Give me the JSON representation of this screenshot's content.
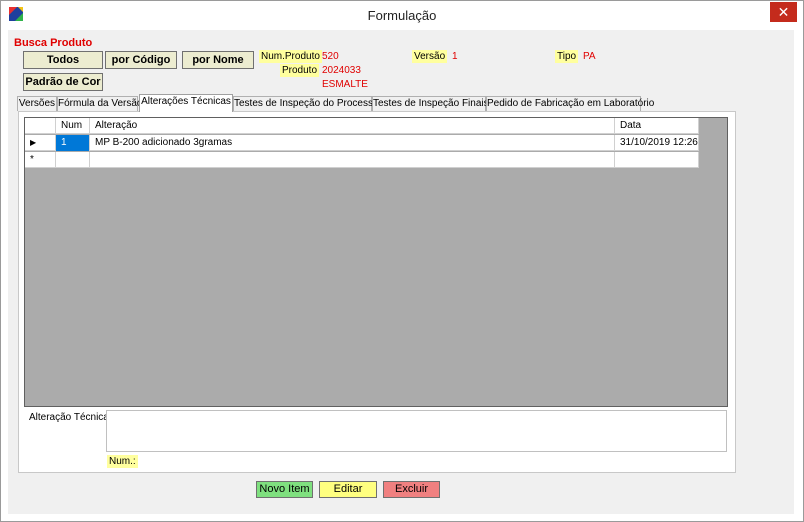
{
  "window": {
    "title": "Formulação",
    "close_glyph": "✕"
  },
  "search": {
    "label": "Busca Produto",
    "buttons": {
      "todos": "Todos",
      "por_codigo": "por Código",
      "por_nome": "por Nome",
      "padrao_cor": "Padrão de Cor"
    }
  },
  "product": {
    "num_produto_label": "Num.Produto",
    "num_produto_value": "520",
    "versao_label": "Versão",
    "versao_value": "1",
    "tipo_label": "Tipo",
    "tipo_value": "PA",
    "produto_label": "Produto",
    "produto_code": "2024033",
    "produto_name": "ESMALTE"
  },
  "tabs": [
    "Versões",
    "Fórmula da Versão",
    "Alterações Técnicas",
    "Testes de Inspeção do Processo",
    "Testes de Inspeção Finais",
    "Pedido de Fabricação em Laboratório"
  ],
  "grid": {
    "columns": [
      "Num",
      "Alteração",
      "Data"
    ],
    "rows": [
      {
        "indicator": "▶",
        "num": "1",
        "alteracao": "MP B-200 adicionado 3gramas",
        "data": "31/10/2019 12:26"
      }
    ],
    "new_row_indicator": "*"
  },
  "detail": {
    "alteracao_tecnica_label": "Alteração Técnica",
    "num_label": "Num.:",
    "text_value": ""
  },
  "actions": {
    "novo_item": "Novo Item",
    "editar": "Editar",
    "excluir": "Excluir"
  },
  "colors": {
    "novo_item_bg": "#7fe07f",
    "editar_bg": "#ffff80",
    "excluir_bg": "#f08080",
    "label_bg": "#ffff9e",
    "value_red": "#e00000"
  },
  "icons": {
    "app": "formulation-app-icon",
    "row_pointer": "row-pointer-icon"
  }
}
